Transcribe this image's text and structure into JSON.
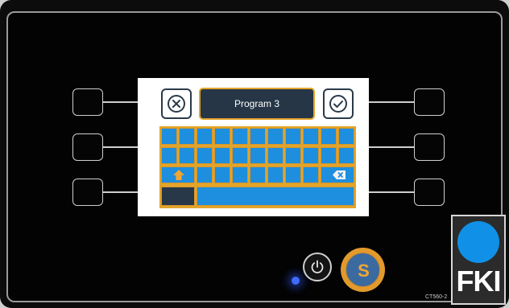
{
  "screen": {
    "title": "Program 3",
    "cancel_icon": "close-circle-icon",
    "confirm_icon": "check-circle-icon"
  },
  "keyboard": {
    "shift_icon": "arrow-up-icon",
    "backspace_icon": "backspace-icon",
    "key_color": "#1e8ede",
    "border_color": "#e3a42a"
  },
  "controls": {
    "power_icon": "power-icon",
    "s_button_label": "S",
    "led_color": "#3d6cff"
  },
  "brand": {
    "logo_text": "FKI",
    "model": "CT560-2"
  }
}
